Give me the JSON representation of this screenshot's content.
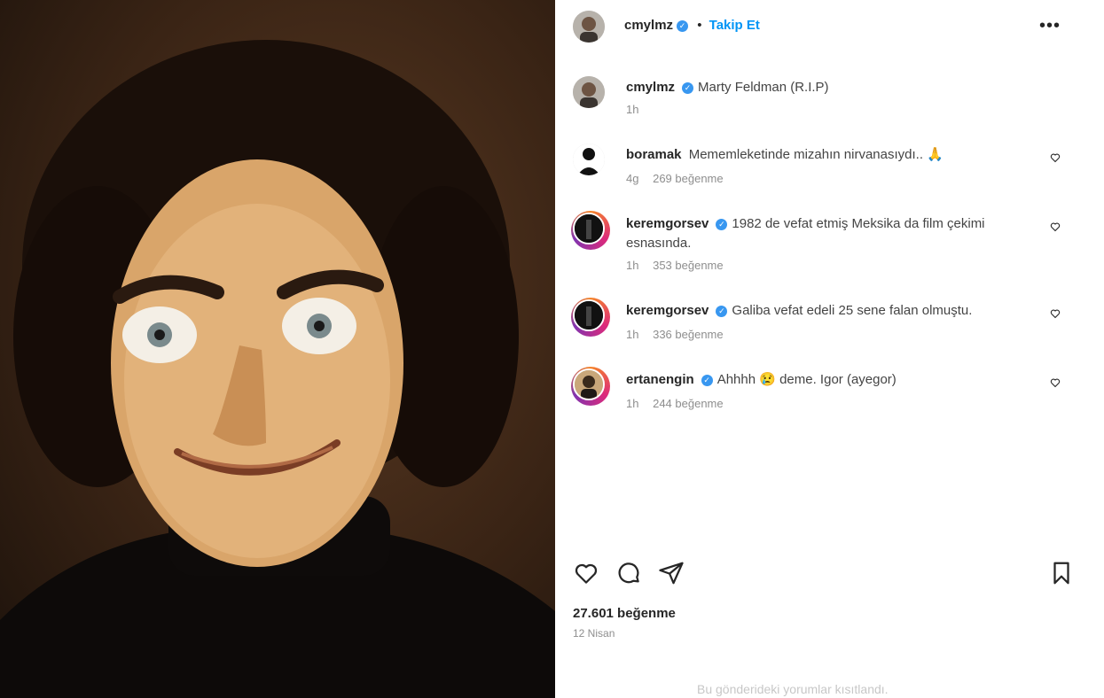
{
  "post": {
    "author": "cmylmz",
    "follow_label": "Takip Et",
    "dot": "•",
    "more_label": "•••",
    "caption": "Marty Feldman (R.I.P)",
    "caption_time": "1h"
  },
  "comments": [
    {
      "user": "boramak",
      "verified": false,
      "text": "Mememleketinde mizahın nirvanasıydı.. 🙏",
      "time": "4g",
      "likes": "269 beğenme"
    },
    {
      "user": "keremgorsev",
      "verified": true,
      "text": "1982 de vefat etmiş Meksika da film çekimi esnasında.",
      "time": "1h",
      "likes": "353 beğenme"
    },
    {
      "user": "keremgorsev",
      "verified": true,
      "text": "Galiba vefat edeli 25 sene falan olmuştu.",
      "time": "1h",
      "likes": "336 beğenme"
    },
    {
      "user": "ertanengin",
      "verified": true,
      "text": "Ahhhh 😢 deme. Igor (ayegor)",
      "time": "1h",
      "likes": "244 beğenme"
    }
  ],
  "stats": {
    "likes": "27.601 beğenme",
    "date": "12 Nisan"
  },
  "footer": {
    "note": "Bu gönderideki yorumlar kısıtlandı."
  },
  "icons": {
    "like": "heart-icon",
    "comment": "comment-icon",
    "share": "share-icon",
    "save": "bookmark-icon",
    "more": "more-icon",
    "verified": "verified-badge-icon"
  },
  "colors": {
    "link": "#0095f6",
    "verified": "#3897f0",
    "muted": "#8e8e8e"
  }
}
